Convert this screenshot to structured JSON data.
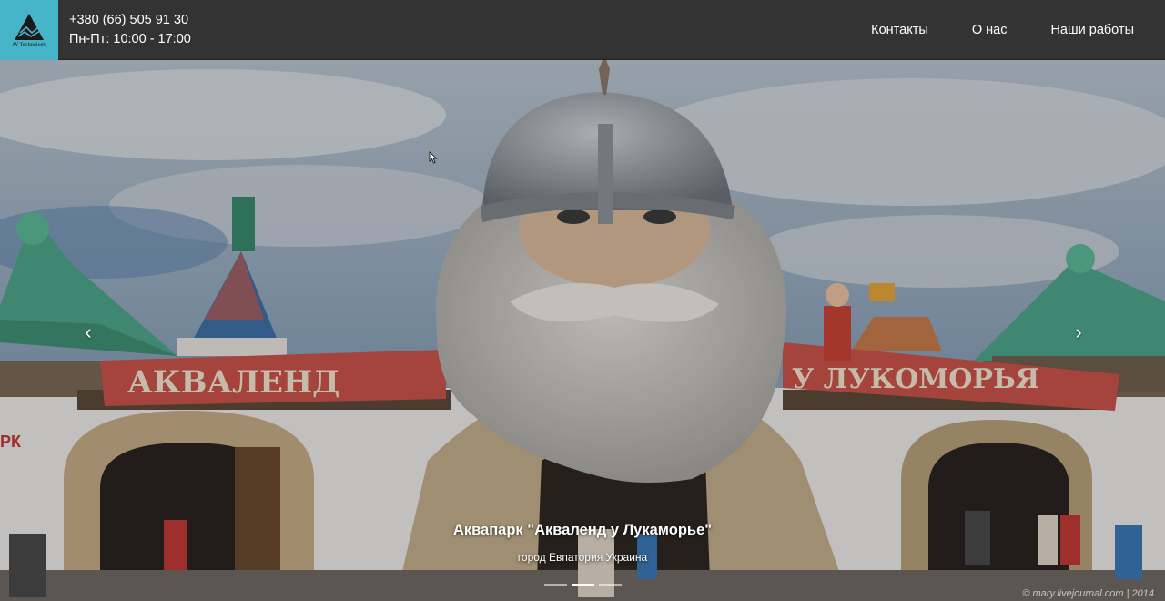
{
  "header": {
    "logo_caption": "AV Technology",
    "phone": "+380 (66) 505 91 30",
    "hours": "Пн-Пт: 10:00 - 17:00",
    "nav": [
      {
        "label": "Контакты"
      },
      {
        "label": "О нас"
      },
      {
        "label": "Наши работы"
      }
    ]
  },
  "carousel": {
    "slide_title": "Аквапарк \"Акваленд у Лукаморье\"",
    "slide_subtitle": "город Евпатория Украина",
    "banner_left": "АКВАЛЕНД",
    "banner_right": "У ЛУКОМОРЬЯ",
    "sign_fragment": "РК",
    "prev_icon": "chevron-left-icon",
    "next_icon": "chevron-right-icon",
    "indicator_count": 3,
    "active_indicator": 2,
    "watermark": "© mary.livejournal.com | 2014"
  },
  "colors": {
    "header_bg": "#333333",
    "logo_bg": "#46b4c9",
    "text": "#ffffff"
  }
}
